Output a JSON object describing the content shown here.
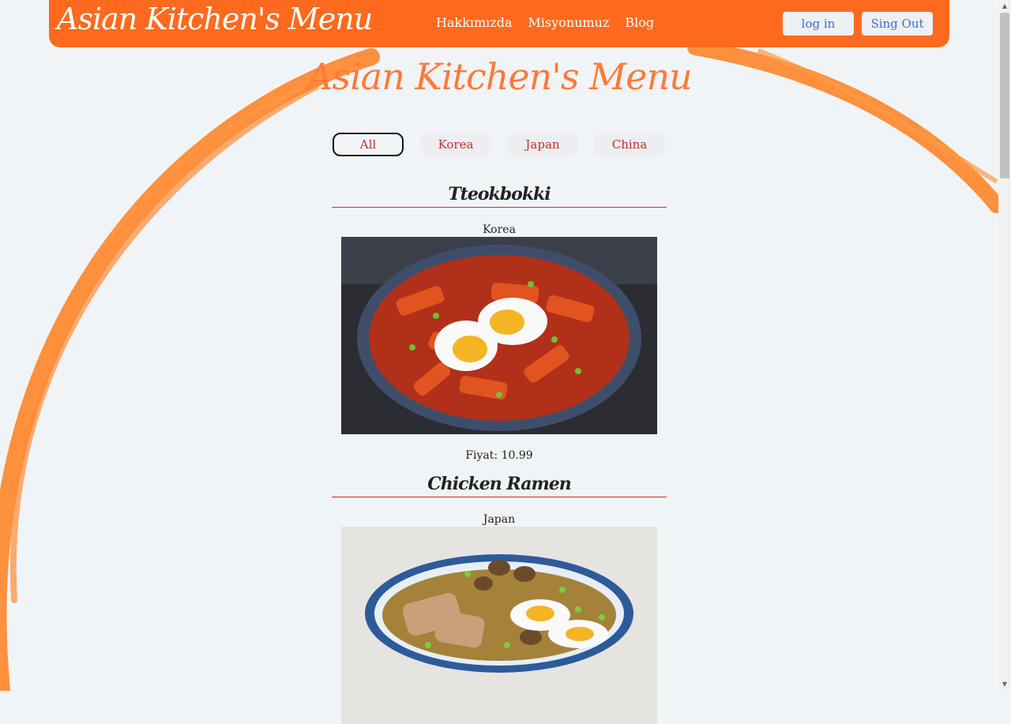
{
  "nav": {
    "brand": "Asian Kitchen's Menu",
    "links": [
      "Hakkımızda",
      "Misyonumuz",
      "Blog"
    ],
    "login_label": "log in",
    "signout_label": "Sing Out"
  },
  "hero": {
    "title": "Asian Kitchen's Menu"
  },
  "filters": [
    "All",
    "Korea",
    "Japan",
    "China"
  ],
  "filters_selected": "All",
  "items": [
    {
      "title": "Tteokbokki",
      "country": "Korea",
      "price": "Fiyat: 10.99",
      "photo_icon": "tteokbokki-dish-icon"
    },
    {
      "title": "Chicken Ramen",
      "country": "Japan",
      "photo_icon": "ramen-dish-icon"
    }
  ],
  "colors": {
    "accent": "#ff6a1f",
    "title_orange": "#ff7a3a",
    "filter_text": "#c8302a",
    "button_text": "#3a6fd8",
    "background": "#f1f4f7"
  }
}
